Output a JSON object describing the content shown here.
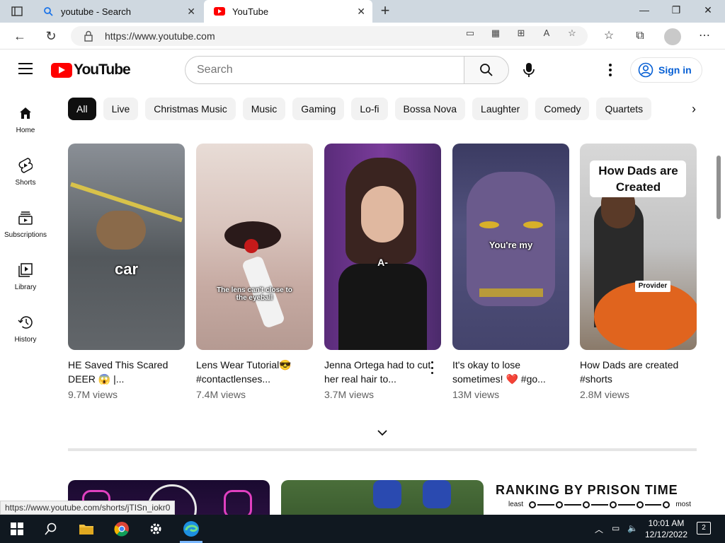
{
  "browser": {
    "tabs": [
      {
        "title": "youtube - Search",
        "active": false
      },
      {
        "title": "YouTube",
        "active": true
      }
    ],
    "url": "https://www.youtube.com",
    "status_url": "https://www.youtube.com/shorts/jTISn_iokr0"
  },
  "header": {
    "logo_text": "YouTube",
    "search_placeholder": "Search",
    "signin_label": "Sign in"
  },
  "sidebar": {
    "items": [
      {
        "label": "Home",
        "icon": "home-icon"
      },
      {
        "label": "Shorts",
        "icon": "shorts-icon"
      },
      {
        "label": "Subscriptions",
        "icon": "subscriptions-icon"
      },
      {
        "label": "Library",
        "icon": "library-icon"
      },
      {
        "label": "History",
        "icon": "history-icon"
      }
    ]
  },
  "chips": [
    "All",
    "Live",
    "Christmas Music",
    "Music",
    "Gaming",
    "Lo-fi",
    "Bossa Nova",
    "Laughter",
    "Comedy",
    "Quartets"
  ],
  "shorts": [
    {
      "title": "HE Saved This Scared DEER 😱 |...",
      "views": "9.7M views",
      "caption": "car"
    },
    {
      "title": "Lens Wear Tutorial😎 #contactlenses...",
      "views": "7.4M views",
      "caption": "The lens can't close to the eyeball"
    },
    {
      "title": "Jenna Ortega had to cut her real hair to...",
      "views": "3.7M views",
      "caption": "A-"
    },
    {
      "title": "It's okay to lose sometimes! ❤️ #go...",
      "views": "13M views",
      "caption": "You're my"
    },
    {
      "title": "How Dads are created #shorts",
      "views": "2.8M views",
      "caption": "How Dads are Created",
      "badge": "Provider"
    }
  ],
  "ranking": {
    "title": "RANKING BY PRISON TIME",
    "least": "least",
    "most": "most",
    "steps": [
      "1",
      "2",
      "3",
      "4",
      "5",
      "6"
    ]
  },
  "taskbar": {
    "time": "10:01 AM",
    "date": "12/12/2022",
    "notifications": "2"
  },
  "colors": {
    "youtube_red": "#ff0000",
    "signin_blue": "#065fd4",
    "taskbar": "#101820"
  }
}
